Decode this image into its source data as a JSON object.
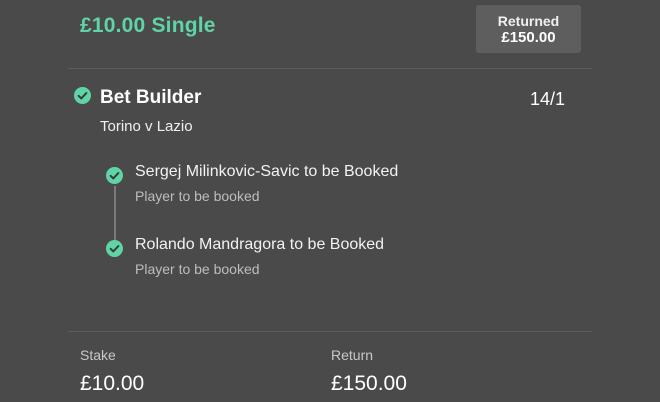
{
  "header": {
    "bet_title": "£10.00 Single",
    "returned_label": "Returned",
    "returned_amount": "£150.00"
  },
  "bet_builder": {
    "title": "Bet Builder",
    "odds": "14/1",
    "match": "Torino v Lazio",
    "legs": [
      {
        "selection": "Sergej Milinkovic-Savic to be Booked",
        "market": "Player to be booked"
      },
      {
        "selection": "Rolando Mandragora to be Booked",
        "market": "Player to be booked"
      }
    ]
  },
  "footer": {
    "stake_label": "Stake",
    "stake_value": "£10.00",
    "return_label": "Return",
    "return_value": "£150.00"
  },
  "colors": {
    "background": "#4a4a4a",
    "accent_green": "#5fd4a6",
    "badge_background": "#5e5e5e"
  },
  "icons": {
    "selection_status": "check-circle-icon"
  }
}
